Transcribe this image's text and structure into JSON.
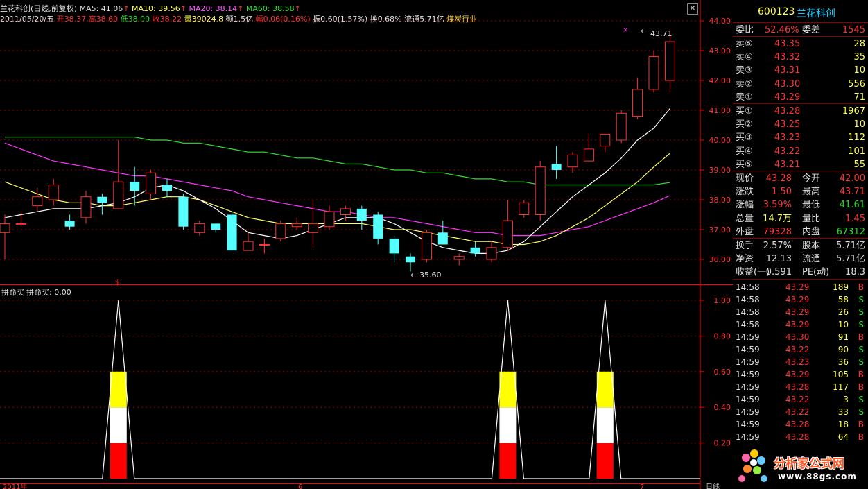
{
  "header": {
    "title": "兰花科创(日线,前复权)",
    "ma5": "MA5: 41.06",
    "ma10": "MA10: 39.56",
    "ma20": "MA20: 38.14",
    "ma60": "MA60: 38.58",
    "arrow": "↑",
    "date": "2011/05/20/五",
    "open": "开38.37",
    "high": "高38.60",
    "low": "低38.00",
    "close": "收38.22",
    "vol": "量39024.8",
    "amt": "额1.5亿",
    "chg": "幅0.06(0.16%)",
    "amp": "振0.60(1.57%)",
    "turn": "换0.68%",
    "float": "流通5.71亿",
    "industry": "煤炭行业",
    "close_icon": "✕"
  },
  "colors": {
    "up": "#ff3333",
    "down": "#55ffff",
    "ma5": "#ffffff",
    "ma10": "#ffff66",
    "ma20": "#ff33ff",
    "ma60": "#33dd33",
    "axis": "#ff0000",
    "grid": "#8b0000"
  },
  "icons": {
    "marker": "$",
    "cross": "×"
  },
  "chart_data": [
    {
      "type": "candlestick",
      "name": "price",
      "ylim": [
        35.6,
        44.3
      ],
      "yticks": [
        "44.00",
        "43.00",
        "42.00",
        "41.00",
        "40.00",
        "39.00",
        "38.00",
        "37.00",
        "36.00"
      ],
      "ytick_values": [
        44,
        43,
        42,
        41,
        40,
        39,
        38,
        37,
        36
      ],
      "hi_label": "43.71",
      "lo_label": "35.60",
      "candles": [
        [
          36.9,
          37.2,
          37.5,
          36.0
        ],
        [
          37.2,
          37.2,
          37.6,
          37.1
        ],
        [
          37.8,
          38.1,
          38.4,
          37.6
        ],
        [
          38.0,
          38.5,
          38.7,
          37.8
        ],
        [
          37.3,
          37.1,
          37.5,
          37.0
        ],
        [
          37.4,
          38.1,
          38.3,
          37.2
        ],
        [
          38.1,
          37.9,
          38.2,
          37.5
        ],
        [
          37.7,
          38.6,
          40.0,
          37.7
        ],
        [
          38.6,
          38.3,
          39.1,
          37.8
        ],
        [
          38.2,
          38.9,
          39.0,
          38.0
        ],
        [
          38.5,
          38.3,
          38.7,
          38.1
        ],
        [
          38.1,
          37.1,
          38.2,
          37.0
        ],
        [
          36.9,
          37.2,
          37.3,
          36.8
        ],
        [
          37.2,
          37.0,
          37.2,
          36.9
        ],
        [
          37.5,
          36.3,
          37.6,
          36.3
        ],
        [
          36.3,
          36.6,
          36.9,
          36.3
        ],
        [
          36.5,
          36.5,
          36.7,
          36.2
        ],
        [
          36.7,
          37.2,
          37.3,
          36.6
        ],
        [
          37.1,
          37.2,
          37.4,
          37.0
        ],
        [
          36.9,
          37.2,
          38.0,
          36.4
        ],
        [
          37.1,
          37.6,
          37.8,
          37.0
        ],
        [
          37.5,
          37.7,
          37.8,
          37.3
        ],
        [
          37.7,
          37.3,
          37.8,
          37.0
        ],
        [
          37.5,
          36.7,
          37.6,
          36.5
        ],
        [
          36.7,
          36.2,
          36.8,
          35.9
        ],
        [
          36.1,
          35.9,
          36.2,
          35.6
        ],
        [
          36.0,
          36.9,
          37.0,
          35.9
        ],
        [
          36.9,
          36.5,
          37.3,
          36.5
        ],
        [
          36.0,
          36.1,
          36.2,
          35.8
        ],
        [
          36.4,
          36.2,
          36.6,
          36.1
        ],
        [
          36.0,
          36.4,
          36.6,
          35.9
        ],
        [
          36.4,
          37.3,
          38.0,
          36.3
        ],
        [
          37.5,
          37.9,
          38.0,
          37.4
        ],
        [
          37.5,
          39.1,
          39.3,
          37.3
        ],
        [
          39.2,
          39.0,
          39.8,
          38.7
        ],
        [
          39.1,
          39.5,
          39.6,
          38.9
        ],
        [
          39.3,
          39.7,
          40.2,
          39.3
        ],
        [
          39.8,
          40.2,
          40.2,
          39.6
        ],
        [
          40.0,
          40.9,
          41.0,
          39.9
        ],
        [
          40.8,
          41.7,
          42.1,
          40.7
        ],
        [
          41.7,
          42.8,
          43.0,
          41.6
        ],
        [
          42.0,
          43.3,
          43.71,
          41.6
        ]
      ],
      "ma5": [
        37.4,
        37.5,
        37.6,
        37.7,
        37.7,
        37.7,
        37.8,
        37.9,
        38.1,
        38.4,
        38.5,
        38.3,
        38.0,
        37.7,
        37.3,
        36.9,
        36.8,
        36.7,
        36.8,
        37.0,
        37.2,
        37.4,
        37.4,
        37.4,
        37.2,
        36.9,
        36.6,
        36.4,
        36.3,
        36.2,
        36.2,
        36.3,
        36.6,
        37.1,
        37.6,
        38.1,
        38.5,
        38.9,
        39.4,
        40.0,
        40.4,
        41.06
      ],
      "ma10": [
        38.6,
        38.4,
        38.2,
        38.0,
        37.9,
        37.9,
        37.8,
        37.8,
        37.9,
        38.0,
        38.1,
        38.1,
        38.0,
        37.8,
        37.6,
        37.4,
        37.3,
        37.2,
        37.2,
        37.2,
        37.2,
        37.2,
        37.2,
        37.1,
        37.0,
        37.0,
        36.9,
        36.8,
        36.7,
        36.6,
        36.6,
        36.5,
        36.5,
        36.6,
        36.8,
        37.1,
        37.4,
        37.8,
        38.2,
        38.6,
        39.1,
        39.56
      ],
      "ma20": [
        39.9,
        39.7,
        39.5,
        39.3,
        39.2,
        39.1,
        39.0,
        38.9,
        38.8,
        38.8,
        38.7,
        38.6,
        38.5,
        38.4,
        38.3,
        38.1,
        38.0,
        37.9,
        37.8,
        37.7,
        37.6,
        37.6,
        37.5,
        37.4,
        37.4,
        37.3,
        37.2,
        37.1,
        37.0,
        36.9,
        36.9,
        36.8,
        36.8,
        36.8,
        36.9,
        37.0,
        37.1,
        37.3,
        37.5,
        37.7,
        37.9,
        38.14
      ],
      "ma60": [
        40.1,
        40.1,
        40.1,
        40.1,
        40.1,
        40.1,
        40.1,
        40.1,
        40.1,
        40.0,
        40.0,
        39.9,
        39.9,
        39.8,
        39.7,
        39.6,
        39.6,
        39.5,
        39.4,
        39.4,
        39.3,
        39.2,
        39.2,
        39.1,
        39.0,
        39.0,
        38.9,
        38.9,
        38.8,
        38.7,
        38.7,
        38.6,
        38.6,
        38.5,
        38.5,
        38.5,
        38.5,
        38.5,
        38.5,
        38.5,
        38.5,
        38.58
      ]
    },
    {
      "type": "bar",
      "name": "拼命买",
      "label": "拼命买",
      "value_label": "拼命买: 0.00",
      "ylim": [
        0,
        1.05
      ],
      "yticks": [
        "1.00",
        "0.80",
        "0.60",
        "0.40",
        "0.20"
      ],
      "ytick_values": [
        1.0,
        0.8,
        0.6,
        0.4,
        0.2
      ],
      "signals": [
        7,
        31,
        37
      ],
      "value": 1.0,
      "bands": [
        {
          "color": "#ff0000",
          "from": 0,
          "to": 0.2
        },
        {
          "color": "#ffffff",
          "from": 0.2,
          "to": 0.4
        },
        {
          "color": "#ffff00",
          "from": 0.4,
          "to": 0.6
        }
      ]
    }
  ],
  "xaxis": {
    "labels": [
      "2011年",
      "6",
      "7"
    ],
    "period": "日线"
  },
  "panel": {
    "code": "600123",
    "name": "兰花科创",
    "webi_label": "委比",
    "webi_value": "52.46%",
    "weicha_label": "委差",
    "weicha_value": "1545",
    "sells": [
      {
        "label": "卖⑤",
        "price": "43.35",
        "vol": "28"
      },
      {
        "label": "卖④",
        "price": "43.32",
        "vol": "35"
      },
      {
        "label": "卖③",
        "price": "43.31",
        "vol": "10"
      },
      {
        "label": "卖②",
        "price": "43.30",
        "vol": "556"
      },
      {
        "label": "卖①",
        "price": "43.29",
        "vol": "71"
      }
    ],
    "buys": [
      {
        "label": "买①",
        "price": "43.28",
        "vol": "1967"
      },
      {
        "label": "买②",
        "price": "43.25",
        "vol": "10"
      },
      {
        "label": "买③",
        "price": "43.23",
        "vol": "112"
      },
      {
        "label": "买④",
        "price": "43.22",
        "vol": "101"
      },
      {
        "label": "买⑤",
        "price": "43.21",
        "vol": "55"
      }
    ],
    "quote": [
      {
        "l1": "现价",
        "v1": "43.28",
        "c1": "#ff3333",
        "l2": "今开",
        "v2": "42.00",
        "c2": "#ff3333"
      },
      {
        "l1": "涨跌",
        "v1": "1.50",
        "c1": "#ff3333",
        "l2": "最高",
        "v2": "43.71",
        "c2": "#ff3333"
      },
      {
        "l1": "涨幅",
        "v1": "3.59%",
        "c1": "#ff3333",
        "l2": "最低",
        "v2": "41.61",
        "c2": "#22dd22"
      },
      {
        "l1": "总量",
        "v1": "14.7万",
        "c1": "#ffff55",
        "l2": "量比",
        "v2": "1.45",
        "c2": "#ff3333"
      },
      {
        "l1": "外盘",
        "v1": "79328",
        "c1": "#ff3333",
        "l2": "内盘",
        "v2": "67312",
        "c2": "#22dd22"
      }
    ],
    "fund": [
      {
        "l1": "换手",
        "v1": "2.57%",
        "l2": "股本",
        "v2": "5.71亿"
      },
      {
        "l1": "净资",
        "v1": "12.13",
        "l2": "流通",
        "v2": "5.71亿"
      },
      {
        "l1": "收益(一)",
        "v1": "0.591",
        "l2": "PE(动)",
        "v2": "18.3"
      }
    ],
    "trades": [
      {
        "t": "14:58",
        "p": "43.29",
        "v": "189",
        "s": "B"
      },
      {
        "t": "14:58",
        "p": "43.29",
        "v": "58",
        "s": "S"
      },
      {
        "t": "14:58",
        "p": "43.29",
        "v": "26",
        "s": "S"
      },
      {
        "t": "14:58",
        "p": "43.29",
        "v": "10",
        "s": "S"
      },
      {
        "t": "14:59",
        "p": "43.30",
        "v": "91",
        "s": "B"
      },
      {
        "t": "14:59",
        "p": "43.22",
        "v": "90",
        "s": "S"
      },
      {
        "t": "14:59",
        "p": "43.23",
        "v": "36",
        "s": "S"
      },
      {
        "t": "14:59",
        "p": "43.29",
        "v": "105",
        "s": "B"
      },
      {
        "t": "14:59",
        "p": "43.28",
        "v": "117",
        "s": "B"
      },
      {
        "t": "14:59",
        "p": "43.22",
        "v": "3",
        "s": "S"
      },
      {
        "t": "14:59",
        "p": "43.22",
        "v": "33",
        "s": "S"
      },
      {
        "t": "14:59",
        "p": "43.28",
        "v": "18",
        "s": "B"
      },
      {
        "t": "14:59",
        "p": "43.28",
        "v": "64",
        "s": "B"
      }
    ]
  },
  "watermark": {
    "text": "分析家公式网",
    "url": "www.88gs.com"
  }
}
